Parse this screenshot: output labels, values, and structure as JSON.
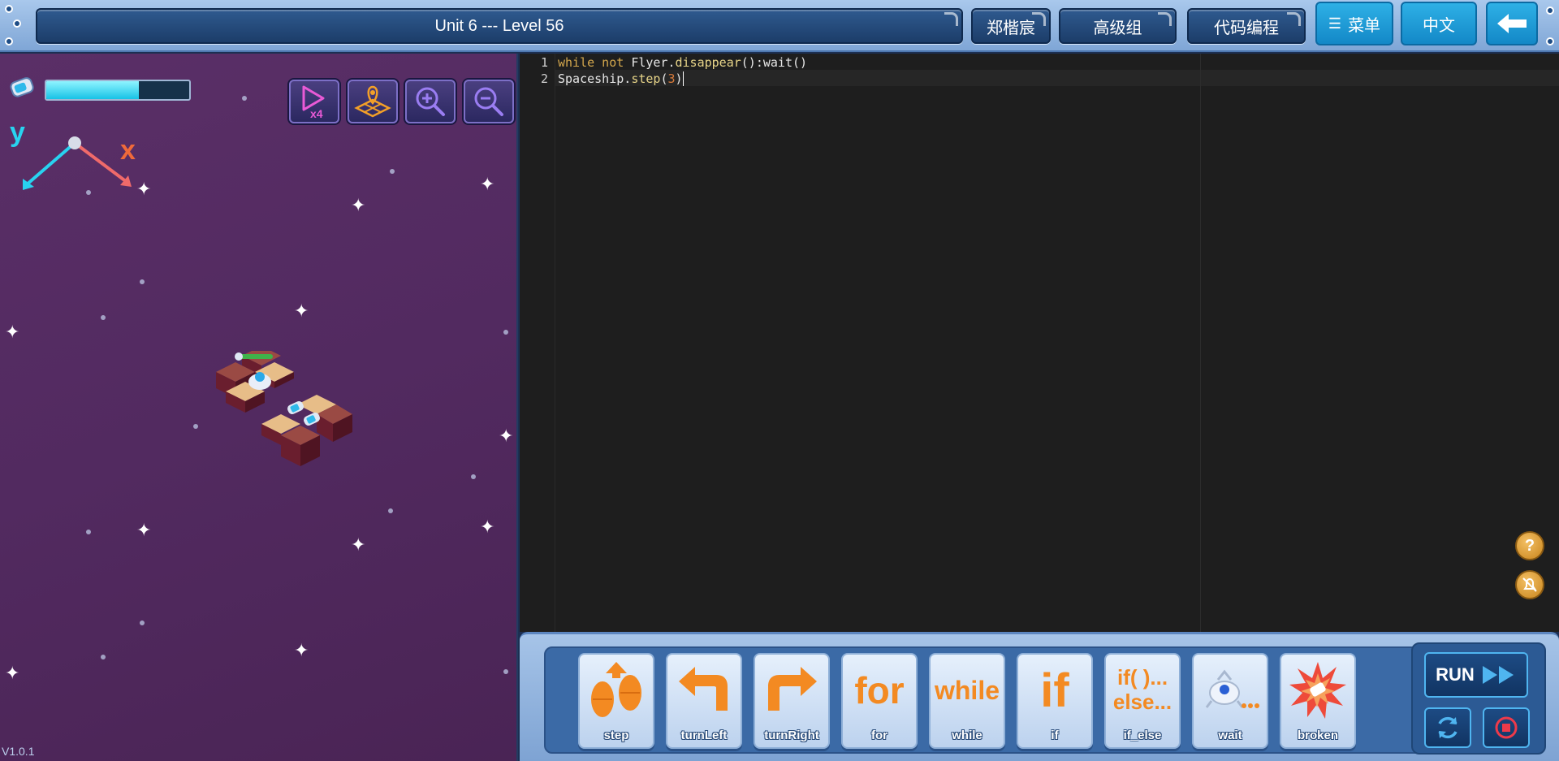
{
  "header": {
    "title": "Unit 6 --- Level 56",
    "user_name": "郑楷宸",
    "group": "高级组",
    "mode": "代码编程",
    "menu_label": "菜单",
    "language_label": "中文"
  },
  "game": {
    "energy_level_percent": 65,
    "axis_y_label": "y",
    "axis_x_label": "x",
    "speed_label": "x4",
    "version": "V1.0.1"
  },
  "editor": {
    "line_numbers": [
      "1",
      "2"
    ]
  },
  "blocks": [
    {
      "label": "step"
    },
    {
      "label": "turnLeft"
    },
    {
      "label": "turnRight"
    },
    {
      "label": "for",
      "glyph": "for"
    },
    {
      "label": "while",
      "glyph": "while"
    },
    {
      "label": "if",
      "glyph": "if"
    },
    {
      "label": "if_else",
      "glyph_top": "if( )...",
      "glyph_bottom": "else..."
    },
    {
      "label": "wait"
    },
    {
      "label": "broken"
    }
  ],
  "controls": {
    "run_label": "RUN"
  },
  "colors": {
    "accent_blue": "#1388c7",
    "game_bg": "#522a60",
    "editor_bg": "#1e1e1e",
    "block_orange": "#f38a22"
  }
}
